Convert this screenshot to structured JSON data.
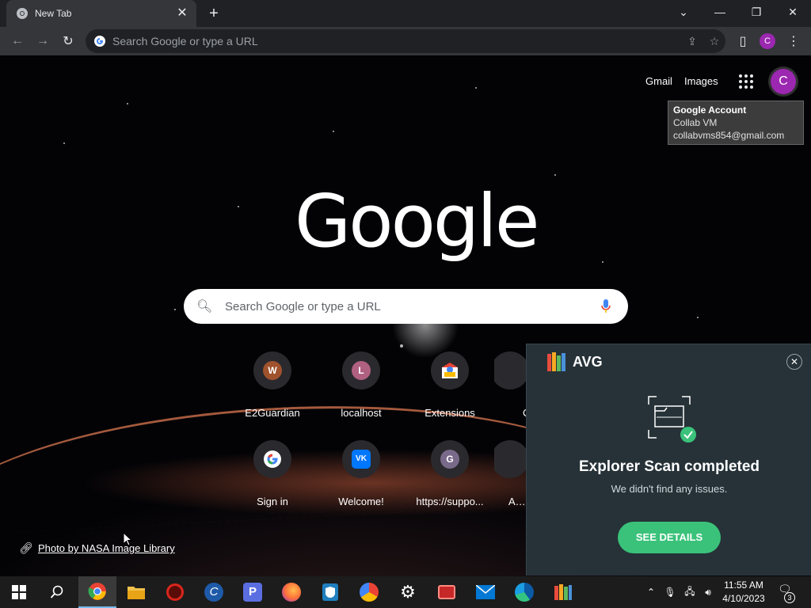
{
  "tab": {
    "title": "New Tab"
  },
  "omnibox": {
    "placeholder": "Search Google or type a URL"
  },
  "profile": {
    "initial": "C"
  },
  "header_links": {
    "gmail": "Gmail",
    "images": "Images"
  },
  "account_tooltip": {
    "title": "Google Account",
    "name": "Collab VM",
    "email": "collabvms854@gmail.com"
  },
  "logo_text": "Google",
  "search": {
    "placeholder": "Search Google or type a URL"
  },
  "shortcuts": [
    {
      "label": "E2Guardian",
      "letter": "W",
      "color": "#a0522d"
    },
    {
      "label": "localhost",
      "letter": "L",
      "color": "#b06080"
    },
    {
      "label": "Extensions",
      "icon": "extensions-icon"
    },
    {
      "label": "Sign in",
      "icon": "google-g-icon"
    },
    {
      "label": "Welcome!",
      "icon": "vk-icon"
    },
    {
      "label": "https://suppo...",
      "letter": "G",
      "color": "#7a6a8a"
    }
  ],
  "shortcuts_partial": [
    {
      "label": "C"
    },
    {
      "label": "Add"
    }
  ],
  "photo_credit": "Photo by NASA Image Library",
  "avg": {
    "brand": "AVG",
    "title": "Explorer Scan completed",
    "subtitle": "We didn't find any issues.",
    "button": "SEE DETAILS"
  },
  "taskbar": {
    "time": "11:55 AM",
    "date": "4/10/2023",
    "notification_count": "3"
  }
}
